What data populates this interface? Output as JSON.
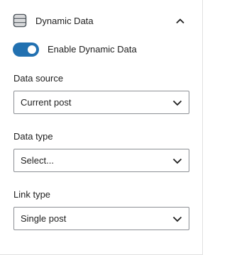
{
  "panel": {
    "title": "Dynamic Data",
    "icon": "database-icon",
    "expanded": true
  },
  "toggle": {
    "label": "Enable Dynamic Data",
    "checked": true,
    "accent_color": "#2271b1"
  },
  "fields": [
    {
      "label": "Data source",
      "value": "Current post"
    },
    {
      "label": "Data type",
      "value": "Select..."
    },
    {
      "label": "Link type",
      "value": "Single post"
    }
  ]
}
